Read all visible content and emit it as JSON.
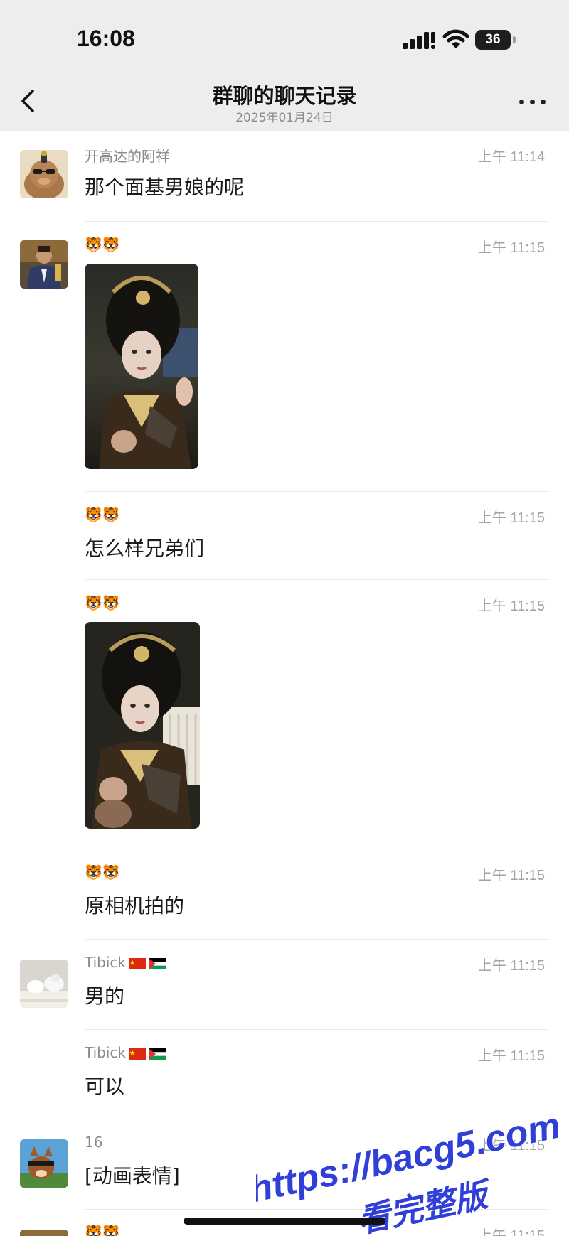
{
  "status_bar": {
    "time": "16:08",
    "battery": "36"
  },
  "nav": {
    "title": "群聊的聊天记录",
    "subtitle": "2025年01月24日"
  },
  "messages": [
    {
      "sender": "开高达的阿祥",
      "time": "上午 11:14",
      "text": "那个面基男娘的呢"
    },
    {
      "sender": "🐯🐯",
      "time": "上午 11:15",
      "image": "photo-cosplay-1"
    },
    {
      "sender": "🐯🐯",
      "time": "上午 11:15",
      "text": "怎么样兄弟们"
    },
    {
      "sender": "🐯🐯",
      "time": "上午 11:15",
      "image": "photo-cosplay-2"
    },
    {
      "sender": "🐯🐯",
      "time": "上午 11:15",
      "text": "原相机拍的"
    },
    {
      "sender": "Tibick",
      "time": "上午 11:15",
      "text": "男的"
    },
    {
      "sender": "Tibick",
      "time": "上午 11:15",
      "text": "可以"
    },
    {
      "sender": "16",
      "time": "上午 11:15",
      "text": "[动画表情]"
    },
    {
      "sender": "🐯🐯",
      "time": "上午 11:15"
    }
  ],
  "watermark": {
    "line1": "https://bacg5.com",
    "line2": "看完整版"
  },
  "colors": {
    "header_bg": "#ededed",
    "divider": "#e8e8e8",
    "watermark": "#2f3fd8"
  }
}
